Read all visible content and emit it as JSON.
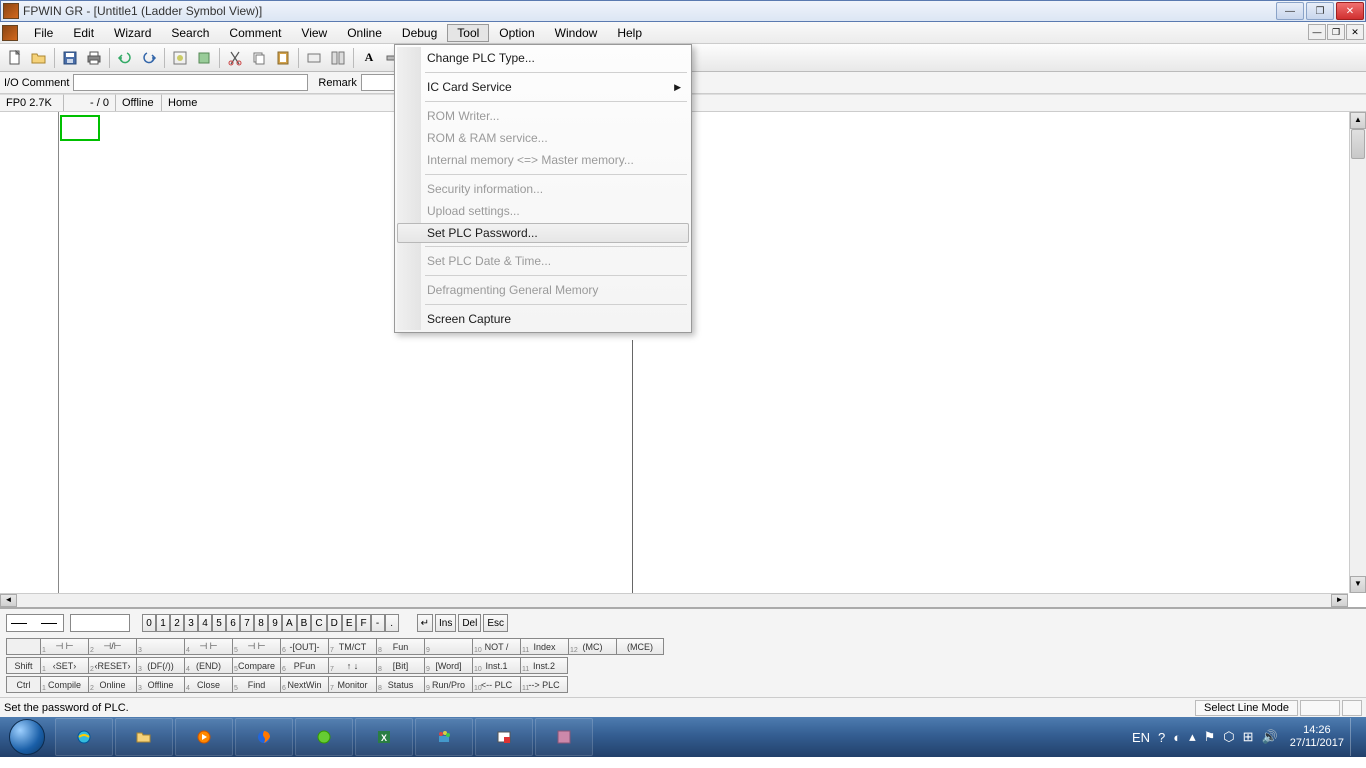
{
  "title": "FPWIN GR - [Untitle1 (Ladder Symbol View)]",
  "menus": {
    "file": "File",
    "edit": "Edit",
    "wizard": "Wizard",
    "search": "Search",
    "comment": "Comment",
    "view": "View",
    "online": "Online",
    "debug": "Debug",
    "tool": "Tool",
    "option": "Option",
    "window": "Window",
    "help": "Help"
  },
  "commentbar": {
    "io_label": "I/O Comment",
    "io_value": "",
    "remark_label": "Remark",
    "remark_value": ""
  },
  "statusrow": {
    "plc": "FP0 2.7K",
    "step": "- /      0",
    "mode": "Offline",
    "pos": "Home"
  },
  "dropdown": {
    "change_plc": "Change PLC Type...",
    "ic_card": "IC Card Service",
    "rom_writer": "ROM Writer...",
    "rom_ram": "ROM & RAM service...",
    "internal_mem": "Internal memory <=> Master memory...",
    "security": "Security information...",
    "upload": "Upload settings...",
    "set_pwd": "Set PLC Password...",
    "set_datetime": "Set PLC Date & Time...",
    "defrag": "Defragmenting General Memory",
    "screen_cap": "Screen Capture"
  },
  "keyrow": {
    "nums": [
      "0",
      "1",
      "2",
      "3",
      "4",
      "5",
      "6",
      "7",
      "8",
      "9",
      "A",
      "B",
      "C",
      "D",
      "E",
      "F",
      "-",
      "."
    ],
    "ins": "Ins",
    "del": "Del",
    "esc": "Esc"
  },
  "fgrid": {
    "r1_label": "",
    "r1": [
      "⊣ ⊢",
      "⊣/⊢",
      "",
      "⊣ ⊢",
      "⊣ ⊢",
      "-[OUT]-",
      "TM/CT",
      "Fun",
      "",
      "NOT /",
      "Index",
      "(MC)",
      "(MCE)"
    ],
    "r1_subs": [
      "1",
      "2",
      "3",
      "4",
      "5",
      "6",
      "7",
      "8",
      "9",
      "10",
      "11",
      "12"
    ],
    "r2_label": "Shift",
    "r2": [
      "‹SET›",
      "‹RESET›",
      "(DF(/))",
      "(END)",
      "Compare",
      "PFun",
      "↑  ↓",
      "[Bit]",
      "[Word]",
      "Inst.1",
      "Inst.2"
    ],
    "r3_label": "Ctrl",
    "r3": [
      "Compile",
      "Online",
      "Offline",
      "Close",
      "Find",
      "NextWin",
      "Monitor",
      "Status",
      "Run/Pro",
      "<-- PLC",
      "--> PLC"
    ]
  },
  "statusbar": {
    "left": "Set the password of PLC.",
    "mode": "Select Line Mode"
  },
  "systray": {
    "lang": "EN",
    "time": "14:26",
    "date": "27/11/2017"
  }
}
